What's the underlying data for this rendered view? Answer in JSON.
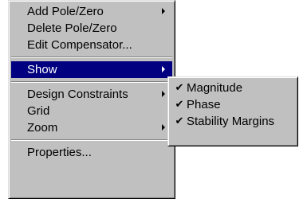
{
  "main_menu": {
    "items": [
      {
        "label": "Add Pole/Zero",
        "has_submenu": true
      },
      {
        "label": "Delete Pole/Zero",
        "has_submenu": false
      },
      {
        "label": "Edit Compensator...",
        "has_submenu": false
      },
      {
        "label": "Show",
        "has_submenu": true,
        "selected": true
      },
      {
        "label": "Design Constraints",
        "has_submenu": true
      },
      {
        "label": "Grid",
        "has_submenu": false
      },
      {
        "label": "Zoom",
        "has_submenu": true
      },
      {
        "label": "Properties...",
        "has_submenu": false
      }
    ]
  },
  "show_submenu": {
    "items": [
      {
        "label": "Magnitude",
        "checked": true
      },
      {
        "label": "Phase",
        "checked": true
      },
      {
        "label": "Stability Margins",
        "checked": true
      }
    ],
    "check_glyph": "✔"
  },
  "colors": {
    "menu_background": "#c0c0c0",
    "selection_background": "#000080",
    "selection_text": "#ffffff"
  }
}
